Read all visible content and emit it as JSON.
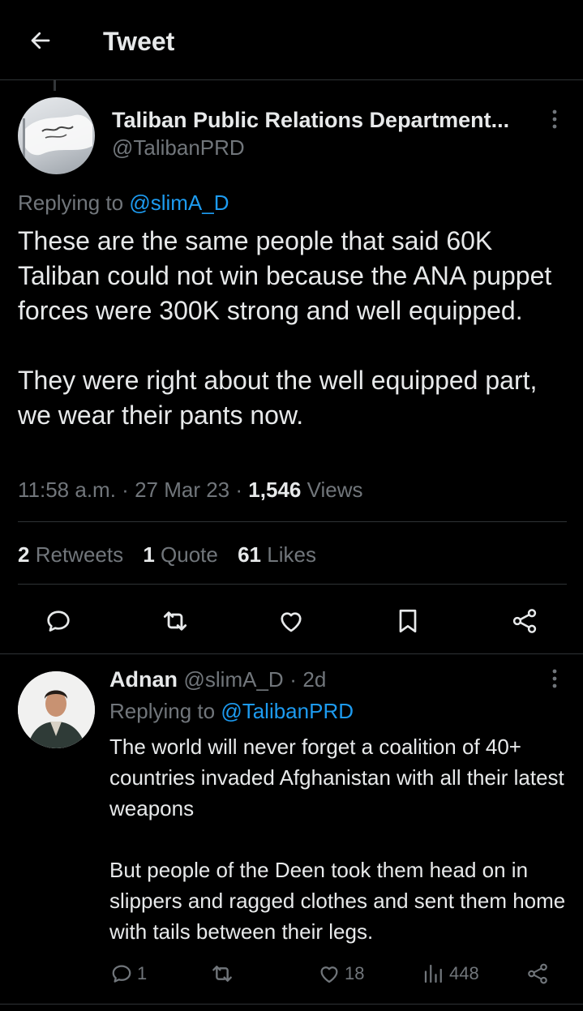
{
  "header": {
    "title": "Tweet"
  },
  "main_tweet": {
    "author_name": "Taliban Public Relations Department...",
    "author_handle": "@TalibanPRD",
    "replying_prefix": "Replying to ",
    "replying_to": "@slimA_D",
    "text_paragraph_1": "These are the same people that said 60K Taliban could not win because the ANA puppet forces were 300K strong and well equipped.",
    "text_paragraph_2": "They were right about the well equipped part, we wear their pants now.",
    "time": "11:58 a.m.",
    "date": "27 Mar 23",
    "views_count": "1,546",
    "views_label": "Views",
    "separator": "·",
    "retweets_count": "2",
    "retweets_label": "Retweets",
    "quotes_count": "1",
    "quotes_label": "Quote",
    "likes_count": "61",
    "likes_label": "Likes"
  },
  "reply": {
    "author_name": "Adnan",
    "author_handle": "@slimA_D",
    "age": "2d",
    "replying_prefix": "Replying to ",
    "replying_to": "@TalibanPRD",
    "text_paragraph_1": "The world will never forget a coalition of 40+ countries invaded Afghanistan with all their latest weapons",
    "text_paragraph_2": "But people of the Deen took them head on in slippers and ragged clothes and sent them home with tails between their legs.",
    "reply_count": "1",
    "like_count": "18",
    "view_count": "448"
  },
  "colors": {
    "background": "#000000",
    "text": "#e7e9ea",
    "secondary": "#71767b",
    "link": "#1d9bf0",
    "divider": "#2f3336"
  },
  "icons": [
    "back-arrow-icon",
    "more-icon",
    "reply-icon",
    "retweet-icon",
    "like-icon",
    "bookmark-icon",
    "share-icon",
    "views-icon"
  ]
}
